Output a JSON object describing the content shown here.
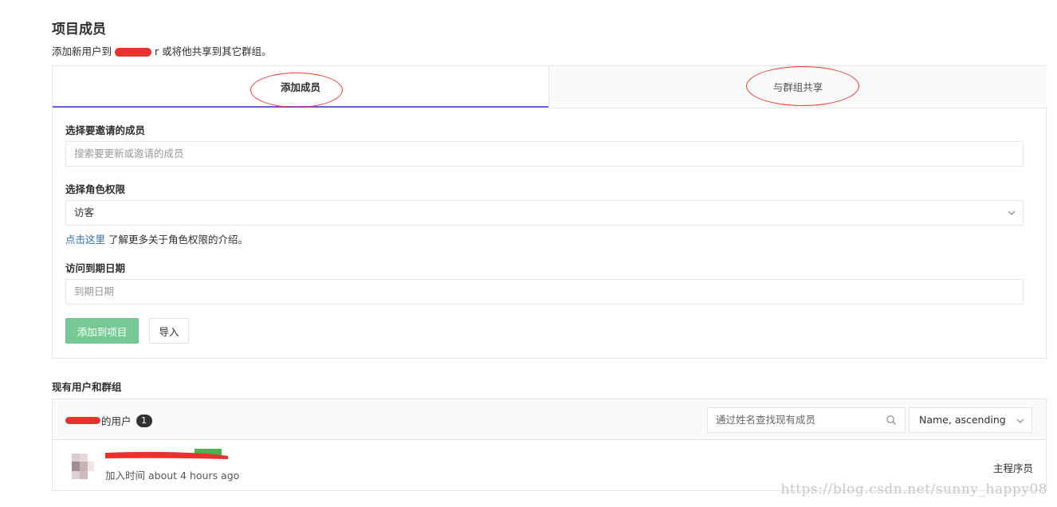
{
  "header": {
    "title": "项目成员",
    "subtitle_prefix": "添加新用户到",
    "subtitle_suffix": "r 或将他共享到其它群组。"
  },
  "tabs": [
    {
      "label": "添加成员",
      "active": true
    },
    {
      "label": "与群组共享",
      "active": false
    }
  ],
  "form": {
    "invite_label": "选择要邀请的成员",
    "invite_placeholder": "搜索要更新或邀请的成员",
    "role_label": "选择角色权限",
    "role_value": "访客",
    "role_help_link": "点击这里",
    "role_help_text": " 了解更多关于角色权限的介绍。",
    "expiry_label": "访问到期日期",
    "expiry_placeholder": "到期日期",
    "add_button": "添加到项目",
    "import_button": "导入"
  },
  "members": {
    "section_title": "现有用户和群组",
    "header_suffix": "的用户",
    "count": "1",
    "search_placeholder": "通过姓名查找现有成员",
    "sort_value": "Name, ascending",
    "rows": [
      {
        "joined": "加入时间 about 4 hours ago",
        "role": "主程序员"
      }
    ]
  },
  "watermark": "https://blog.csdn.net/sunny_happy08",
  "colors": {
    "accent_tab": "#6b63d8",
    "add_button": "#75c995",
    "link": "#2f6ea8",
    "annotation_red": "#e53935"
  },
  "icons": [
    "chevron-down-icon",
    "search-icon"
  ]
}
